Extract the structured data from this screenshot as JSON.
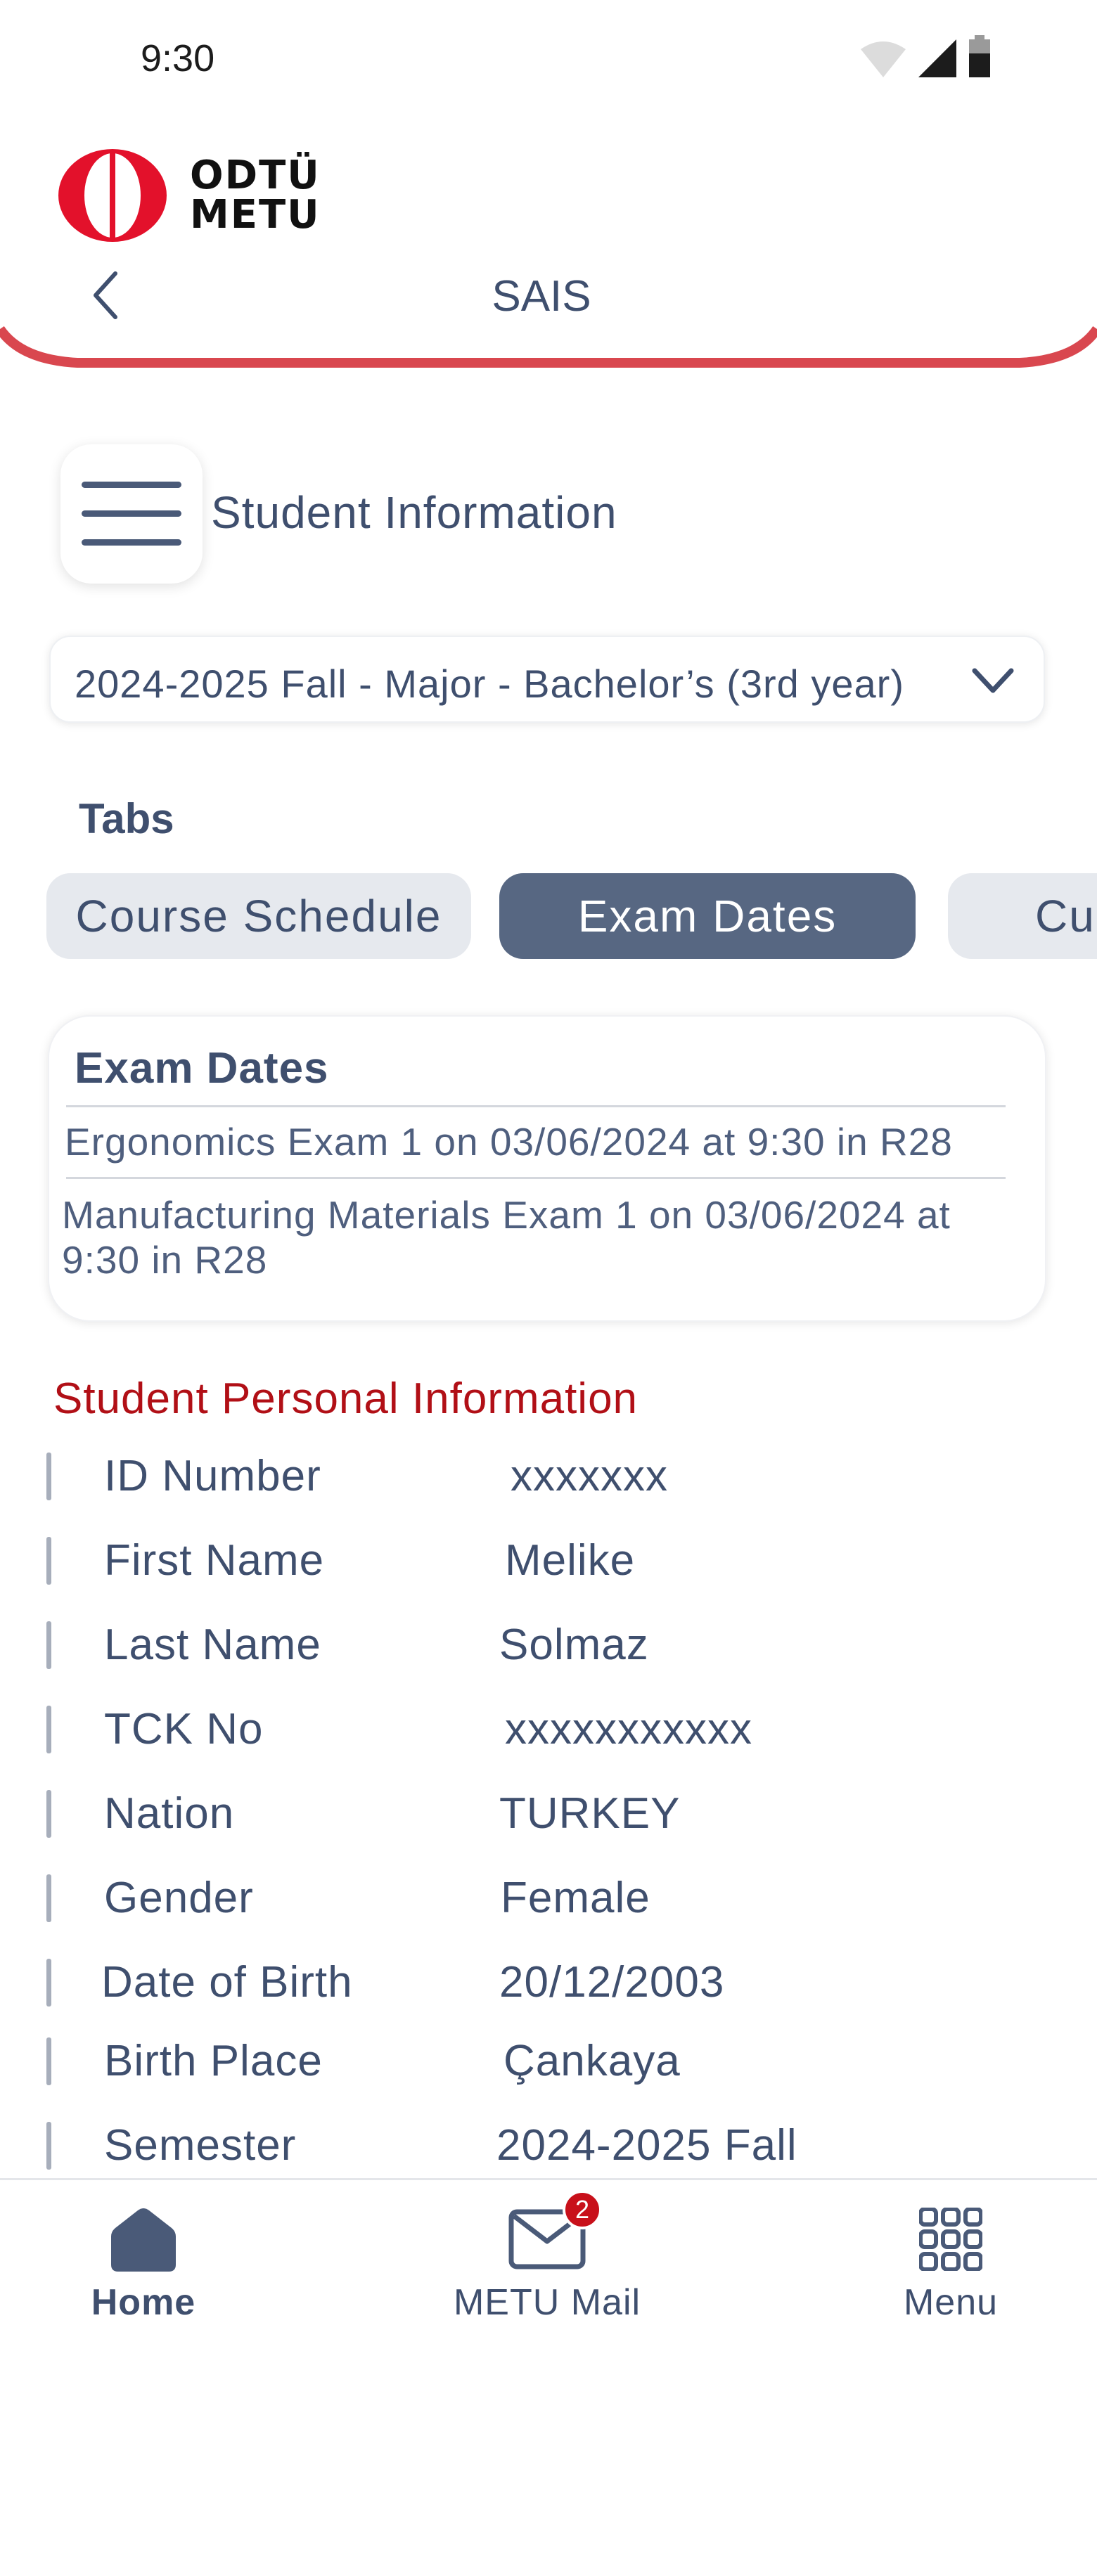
{
  "status_bar": {
    "time": "9:30"
  },
  "header": {
    "logo_line1": "ODTÜ",
    "logo_line2": "METU",
    "title": "SAIS",
    "accent_color": "#d9474f"
  },
  "page": {
    "title": "Student Information",
    "semester_selected": "2024-2025 Fall - Major - Bachelor’s (3rd year)"
  },
  "tabs": {
    "label": "Tabs",
    "items": [
      {
        "label": "Course Schedule",
        "active": false
      },
      {
        "label": "Exam Dates",
        "active": true
      },
      {
        "label": "Cu",
        "active": false
      }
    ]
  },
  "exam_dates": {
    "title": "Exam Dates",
    "items": [
      "Ergonomics Exam 1 on 03/06/2024 at 9:30 in R28",
      "Manufacturing Materials Exam 1 on 03/06/2024 at 9:30 in R28"
    ]
  },
  "personal_info": {
    "title": "Student Personal Information",
    "title_color": "#b10f16",
    "rows": [
      {
        "label": "ID Number",
        "value": "xxxxxxx"
      },
      {
        "label": "First Name",
        "value": "Melike"
      },
      {
        "label": "Last Name",
        "value": "Solmaz"
      },
      {
        "label": "TCK No",
        "value": "xxxxxxxxxxx"
      },
      {
        "label": "Nation",
        "value": "TURKEY"
      },
      {
        "label": "Gender",
        "value": "Female"
      },
      {
        "label": "Date of Birth",
        "value": "20/12/2003"
      },
      {
        "label": "Birth Place",
        "value": "Çankaya"
      },
      {
        "label": "Semester",
        "value": "2024-2025 Fall"
      }
    ]
  },
  "bottom_nav": {
    "items": [
      {
        "label": "Home",
        "icon": "home-icon",
        "active": true
      },
      {
        "label": "METU Mail",
        "icon": "mail-icon",
        "badge": "2"
      },
      {
        "label": "Menu",
        "icon": "grid-icon"
      }
    ]
  }
}
